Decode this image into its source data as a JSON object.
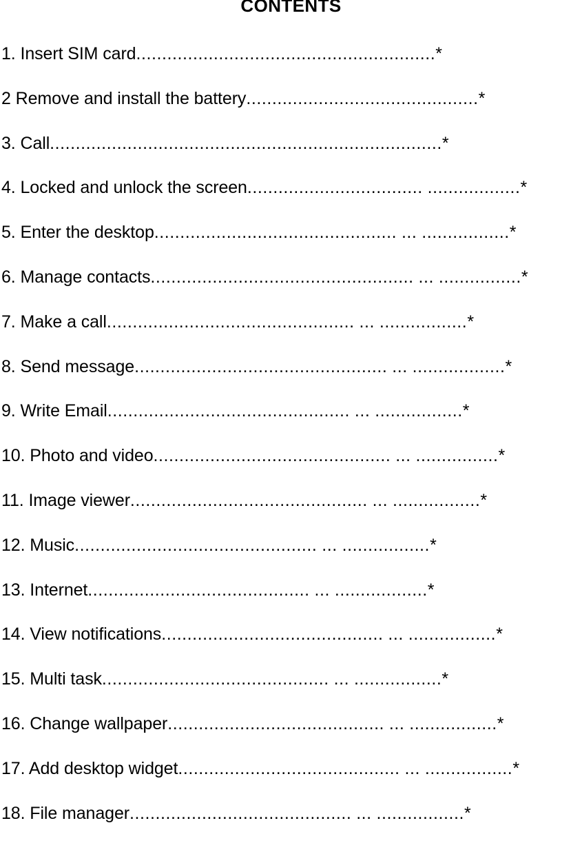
{
  "document": {
    "title": "CONTENTS",
    "page_marker_symbol": "*",
    "background_color": "#ffffff",
    "text_color": "#000000"
  },
  "toc": {
    "entries": [
      {
        "number": "1.",
        "label": "1. Insert SIM card",
        "leader": "..........................................................",
        "gap": "",
        "leader_mid": "",
        "gap2": "",
        "leader_end": "",
        "page": "*"
      },
      {
        "number": "2",
        "label": "2 Remove and install the battery",
        "leader": ".............................................",
        "gap": "",
        "leader_mid": "",
        "gap2": "",
        "leader_end": "",
        "page": "*"
      },
      {
        "number": "3.",
        "label": "3. Call",
        "leader": "............................................................................",
        "gap": "",
        "leader_mid": "",
        "gap2": "",
        "leader_end": "",
        "page": "*"
      },
      {
        "number": "4.",
        "label": "4. Locked and unlock the screen",
        "leader": "..................................",
        "gap": " ",
        "leader_mid": "",
        "gap2": "",
        "leader_end": "..................",
        "page": "*"
      },
      {
        "number": "5.",
        "label": "5. Enter the desktop",
        "leader": "...............................................",
        "gap": " ",
        "leader_mid": "...",
        "gap2": " ",
        "leader_end": ".................",
        "page": "*"
      },
      {
        "number": "6.",
        "label": "6. Manage contacts",
        "leader": "...................................................",
        "gap": " ",
        "leader_mid": "...",
        "gap2": " ",
        "leader_end": "................",
        "page": "*"
      },
      {
        "number": "7.",
        "label": "7. Make a call",
        "leader": "................................................",
        "gap": " ",
        "leader_mid": "...",
        "gap2": " ",
        "leader_end": ".................",
        "page": "*"
      },
      {
        "number": "8.",
        "label": "8. Send message",
        "leader": ".................................................",
        "gap": " ",
        "leader_mid": "...",
        "gap2": " ",
        "leader_end": "..................",
        "page": "*"
      },
      {
        "number": "9.",
        "label": "9. Write Email",
        "leader": "...............................................",
        "gap": " ",
        "leader_mid": "...",
        "gap2": " ",
        "leader_end": ".................",
        "page": "*"
      },
      {
        "number": "10.",
        "label": "10. Photo and video",
        "leader": "..............................................",
        "gap": " ",
        "leader_mid": "...",
        "gap2": " ",
        "leader_end": "................",
        "page": "*"
      },
      {
        "number": "11.",
        "label": "11. Image viewer",
        "leader": "..............................................",
        "gap": " ",
        "leader_mid": "...",
        "gap2": " ",
        "leader_end": ".................",
        "page": "*"
      },
      {
        "number": "12.",
        "label": "12. Music",
        "leader": "...............................................",
        "gap": " ",
        "leader_mid": "...",
        "gap2": " ",
        "leader_end": ".................",
        "page": "*"
      },
      {
        "number": "13.",
        "label": "13. Internet",
        "leader": "...........................................",
        "gap": " ",
        "leader_mid": "...",
        "gap2": " ",
        "leader_end": "..................",
        "page": "*"
      },
      {
        "number": "14.",
        "label": "14. View notifications",
        "leader": "...........................................",
        "gap": " ",
        "leader_mid": "...",
        "gap2": " ",
        "leader_end": ".................",
        "page": "*"
      },
      {
        "number": "15.",
        "label": "15. Multi task",
        "leader": "............................................",
        "gap": " ",
        "leader_mid": "...",
        "gap2": " ",
        "leader_end": ".................",
        "page": "*"
      },
      {
        "number": "16.",
        "label": "16. Change wallpaper",
        "leader": "..........................................",
        "gap": " ",
        "leader_mid": "...",
        "gap2": " ",
        "leader_end": ".................",
        "page": "*"
      },
      {
        "number": "17.",
        "label": "17. Add desktop widget",
        "leader": "...........................................",
        "gap": " ",
        "leader_mid": "...",
        "gap2": " ",
        "leader_end": ".................",
        "page": "*"
      },
      {
        "number": "18.",
        "label": "18. File manager",
        "leader": "...........................................",
        "gap": " ",
        "leader_mid": "...",
        "gap2": " ",
        "leader_end": ".................",
        "page": "*"
      }
    ]
  }
}
